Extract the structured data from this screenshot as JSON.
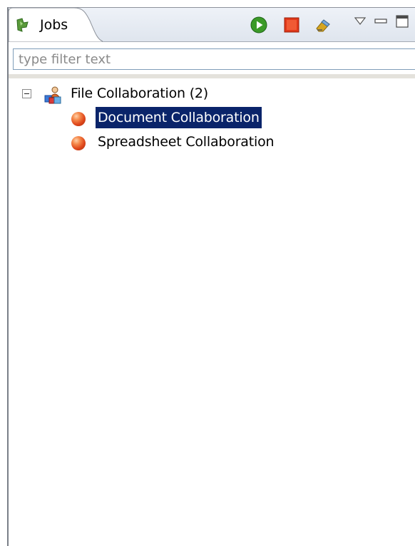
{
  "view": {
    "tab_title": "Jobs",
    "tab_icon": "jobs-icon",
    "toolbar": [
      {
        "name": "run-job-button",
        "icon": "play-icon",
        "color": "#3b9a28"
      },
      {
        "name": "stop-job-button",
        "icon": "stop-icon",
        "color": "#e0381a"
      },
      {
        "name": "clear-jobs-button",
        "icon": "eraser-icon",
        "color": "#d6a520"
      },
      {
        "name": "view-menu-button",
        "icon": "chevron-down-icon",
        "color": "#555555"
      },
      {
        "name": "minimize-button",
        "icon": "minimize-icon",
        "color": "#555555"
      },
      {
        "name": "maximize-button",
        "icon": "maximize-icon",
        "color": "#555555"
      }
    ]
  },
  "filter": {
    "placeholder": "type filter text",
    "value": ""
  },
  "tree": {
    "group": {
      "label": "File Collaboration (2)",
      "expanded": true,
      "icon": "collaboration-group-icon"
    },
    "items": [
      {
        "label": "Document Collaboration",
        "selected": true,
        "icon": "job-ball-icon"
      },
      {
        "label": "Spreadsheet Collaboration",
        "selected": false,
        "icon": "job-ball-icon"
      }
    ]
  },
  "colors": {
    "selection": "#0a246a",
    "job_ball": "#e0481c",
    "tab_background": "#dfe5ee"
  }
}
